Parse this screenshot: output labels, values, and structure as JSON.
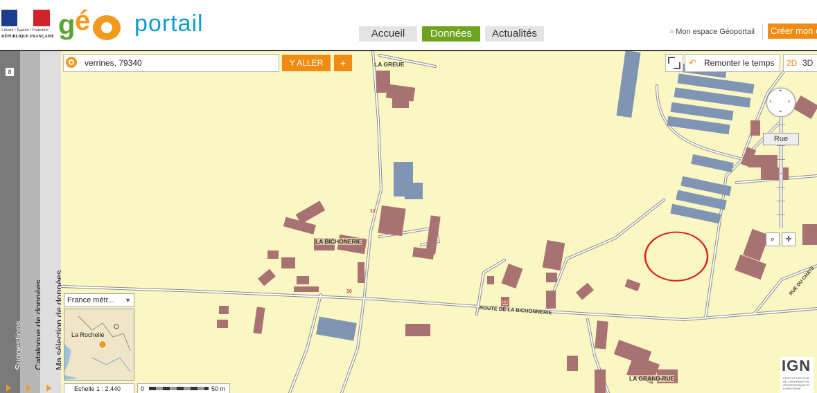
{
  "header": {
    "rf_motto": "Liberté • Égalité • Fraternité",
    "rf_name": "RÉPUBLIQUE FRANÇAISE",
    "logo": {
      "g": "g",
      "e": "é",
      "portail": "portail"
    },
    "nav": [
      {
        "label": "Accueil",
        "active": false
      },
      {
        "label": "Données",
        "active": true
      },
      {
        "label": "Actualités",
        "active": false
      }
    ],
    "espace_link": "Mon espace Géoportail",
    "creer_button": "Créer mon e"
  },
  "sidebar": {
    "suggestions": "Suggestions",
    "suggestions_count": "8",
    "catalogue": "Catalogue de données",
    "selection": "Ma sélection de données"
  },
  "search": {
    "value": "verrines, 79340",
    "go_label": "Y ALLER",
    "plus_label": "+"
  },
  "map_controls": {
    "remonter_label": "Remonter le temps",
    "dim_2d": "2D",
    "dim_3d": "3D",
    "rue_label": "Rue"
  },
  "map_labels": {
    "la_greue": "LA GREUE",
    "la_bichonnerie": "LA BICHONERIE",
    "route_bichonnerie": "ROUTE DE LA BICHONNERIE",
    "la_grand_rue": "LA GRAND-RUE",
    "rue_du_chate": "RUE DU CHATE",
    "road_10": "10",
    "road_12": "12",
    "road_13": "13"
  },
  "minimap": {
    "select_value": "France métr...",
    "place_label": "La Rochelle"
  },
  "scale": {
    "text": "Echelle 1 :  2.440",
    "zero": "0",
    "distance": "50 m"
  },
  "ign": {
    "logo_text": "IGN",
    "subtitle": "INSTITUT NATIONAL DE L'INFORMATION GÉOGRAPHIQUE ET FORESTIÈRE"
  },
  "colors": {
    "map_background": "#fbf7c3",
    "building": "#a87272",
    "large_building": "#7f95b3",
    "accent_orange": "#f08c13",
    "nav_active": "#6ea31f",
    "annotation_circle": "#d81e1e"
  }
}
